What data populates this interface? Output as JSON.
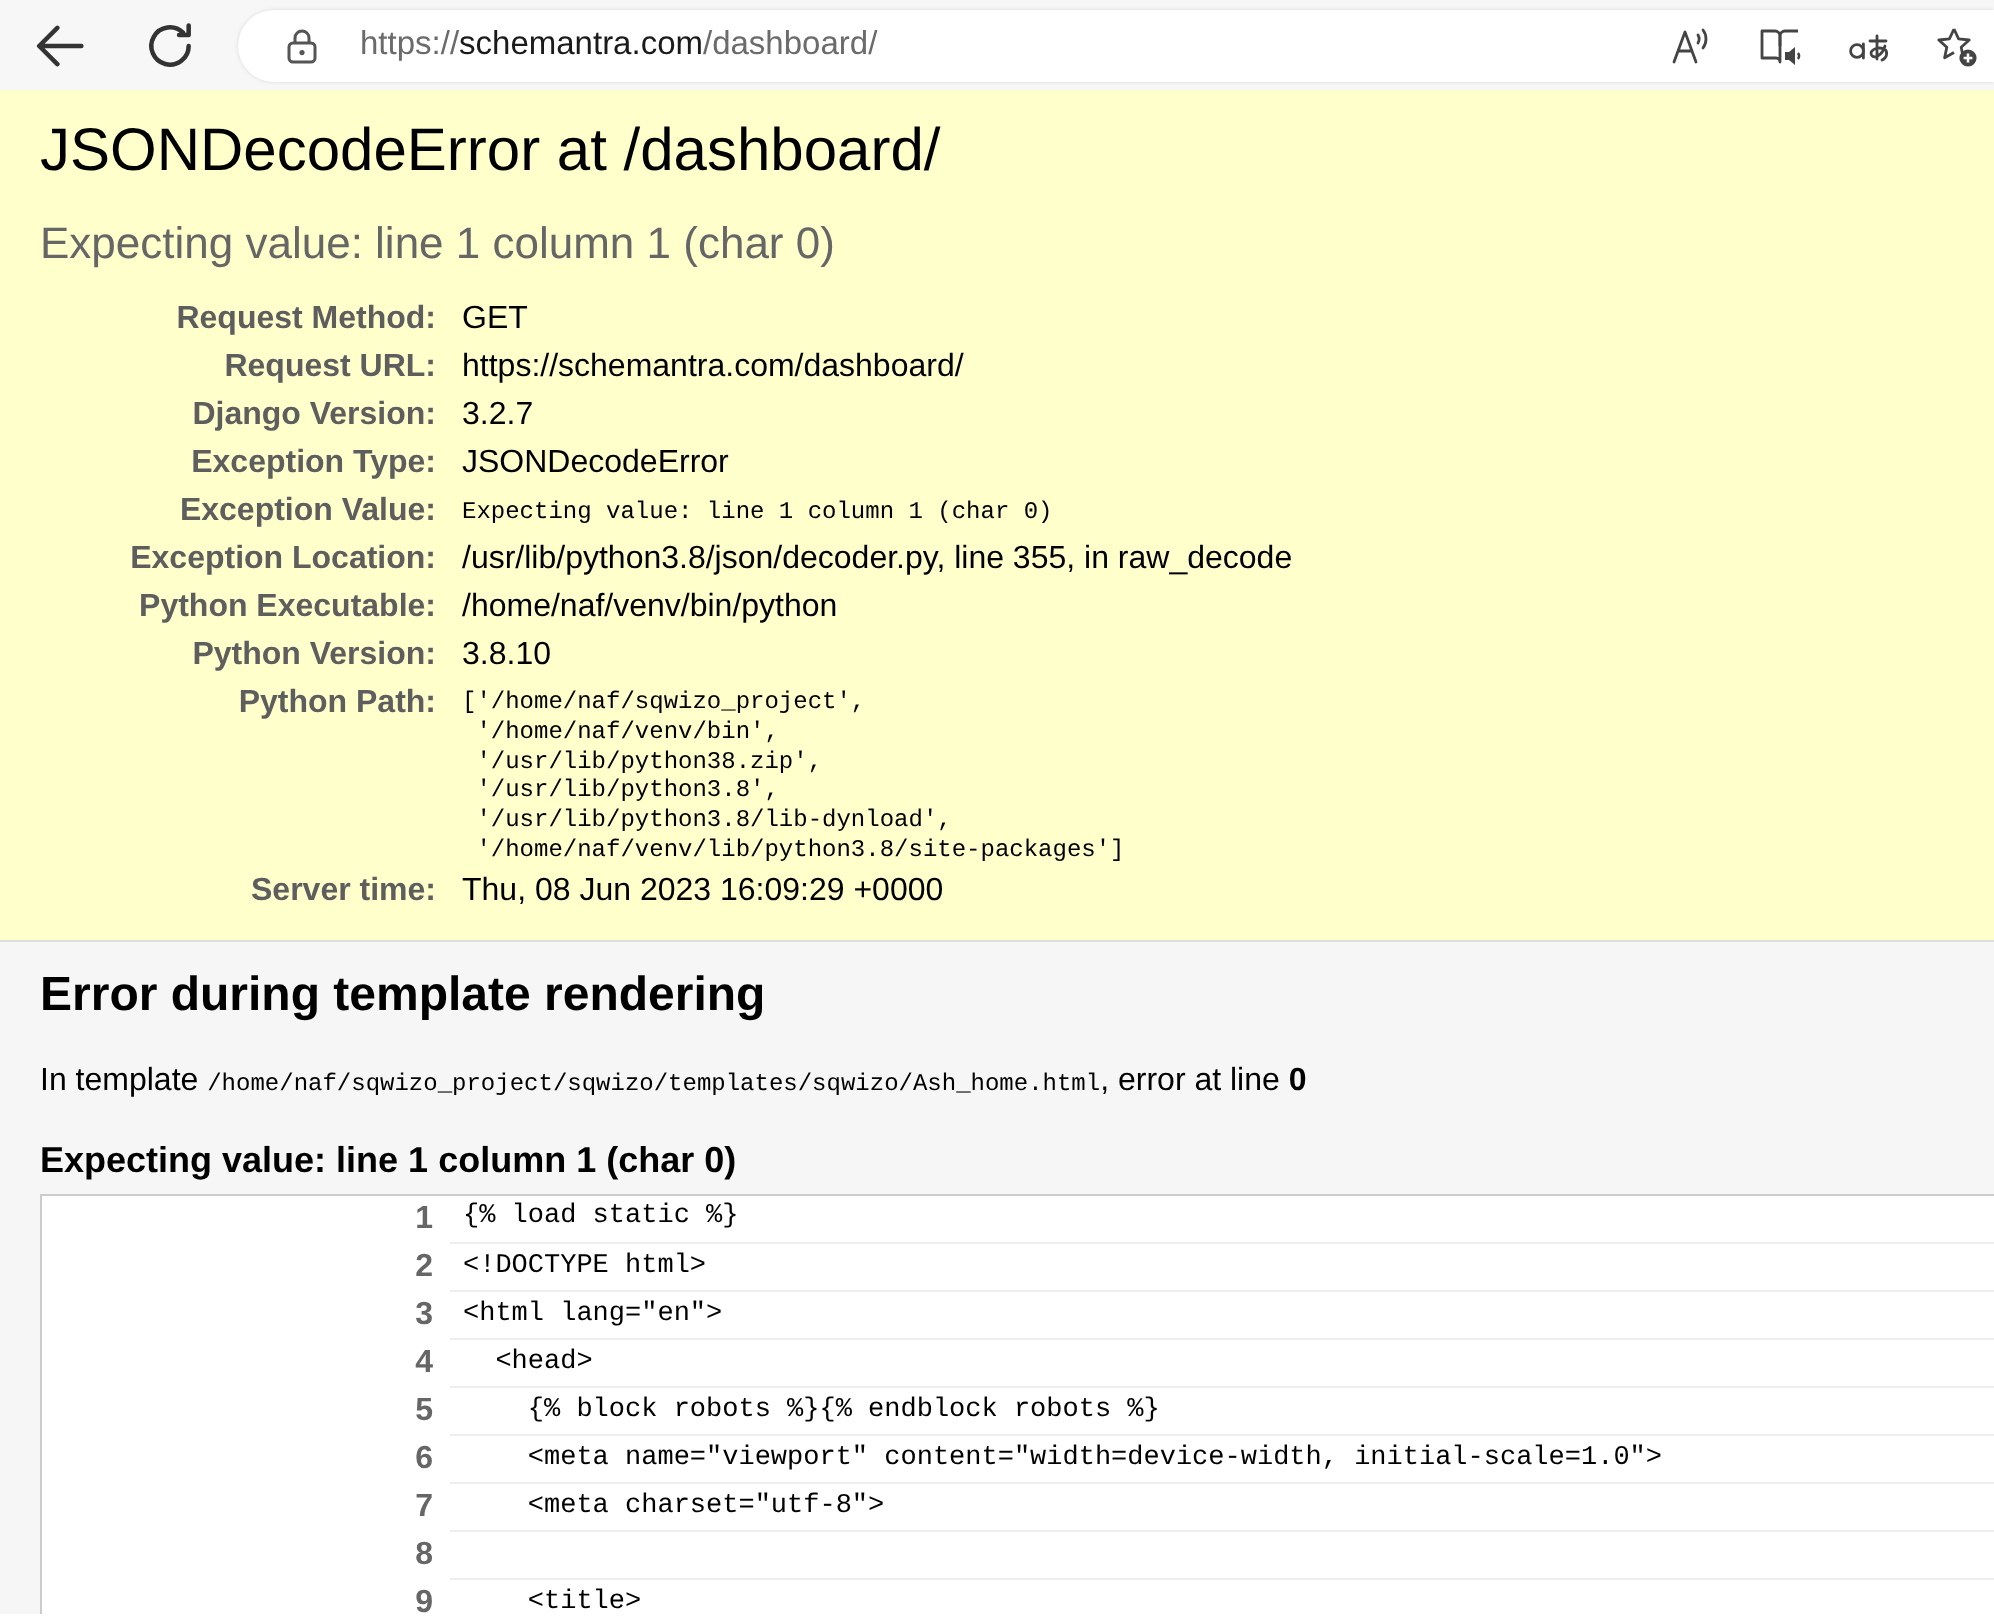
{
  "browser": {
    "url": {
      "scheme": "https://",
      "host": "schemantra.com",
      "path": "/dashboard/"
    }
  },
  "summary": {
    "title": "JSONDecodeError at /dashboard/",
    "subtitle": "Expecting value: line 1 column 1 (char 0)",
    "meta": [
      {
        "label": "Request Method:",
        "kind": "text",
        "value": "GET"
      },
      {
        "label": "Request URL:",
        "kind": "text",
        "value": "https://schemantra.com/dashboard/"
      },
      {
        "label": "Django Version:",
        "kind": "text",
        "value": "3.2.7"
      },
      {
        "label": "Exception Type:",
        "kind": "text",
        "value": "JSONDecodeError"
      },
      {
        "label": "Exception Value:",
        "kind": "code",
        "value": "Expecting value: line 1 column 1 (char 0)"
      },
      {
        "label": "Exception Location:",
        "kind": "text",
        "value": "/usr/lib/python3.8/json/decoder.py, line 355, in raw_decode"
      },
      {
        "label": "Python Executable:",
        "kind": "text",
        "value": "/home/naf/venv/bin/python"
      },
      {
        "label": "Python Version:",
        "kind": "text",
        "value": "3.8.10"
      },
      {
        "label": "Python Path:",
        "kind": "code_block",
        "lines": [
          "['/home/naf/sqwizo_project',",
          " '/home/naf/venv/bin',",
          " '/usr/lib/python38.zip',",
          " '/usr/lib/python3.8',",
          " '/usr/lib/python3.8/lib-dynload',",
          " '/home/naf/venv/lib/python3.8/site-packages']"
        ]
      },
      {
        "label": "Server time:",
        "kind": "text",
        "value": "Thu, 08 Jun 2023 16:09:29 +0000"
      }
    ]
  },
  "template": {
    "heading": "Error during template rendering",
    "intro": {
      "before": "In template",
      "path": "/home/naf/sqwizo_project/sqwizo/templates/sqwizo/Ash_home.html",
      "after": ", error at line **0**"
    },
    "message": "Expecting value: line 1 column 1 (char 0)",
    "code_lines": [
      {
        "number": "1",
        "text": "{% load static %}"
      },
      {
        "number": "2",
        "text": "<!DOCTYPE html>"
      },
      {
        "number": "3",
        "text": "<html lang=\"en\">"
      },
      {
        "number": "4",
        "text": "  <head>"
      },
      {
        "number": "5",
        "text": "    {% block robots %}{% endblock robots %}"
      },
      {
        "number": "6",
        "text": "    <meta name=\"viewport\" content=\"width=device-width, initial-scale=1.0\">"
      },
      {
        "number": "7",
        "text": "    <meta charset=\"utf-8\">"
      },
      {
        "number": "8"
      },
      {
        "number": "9",
        "text": "    <title>"
      }
    ]
  }
}
